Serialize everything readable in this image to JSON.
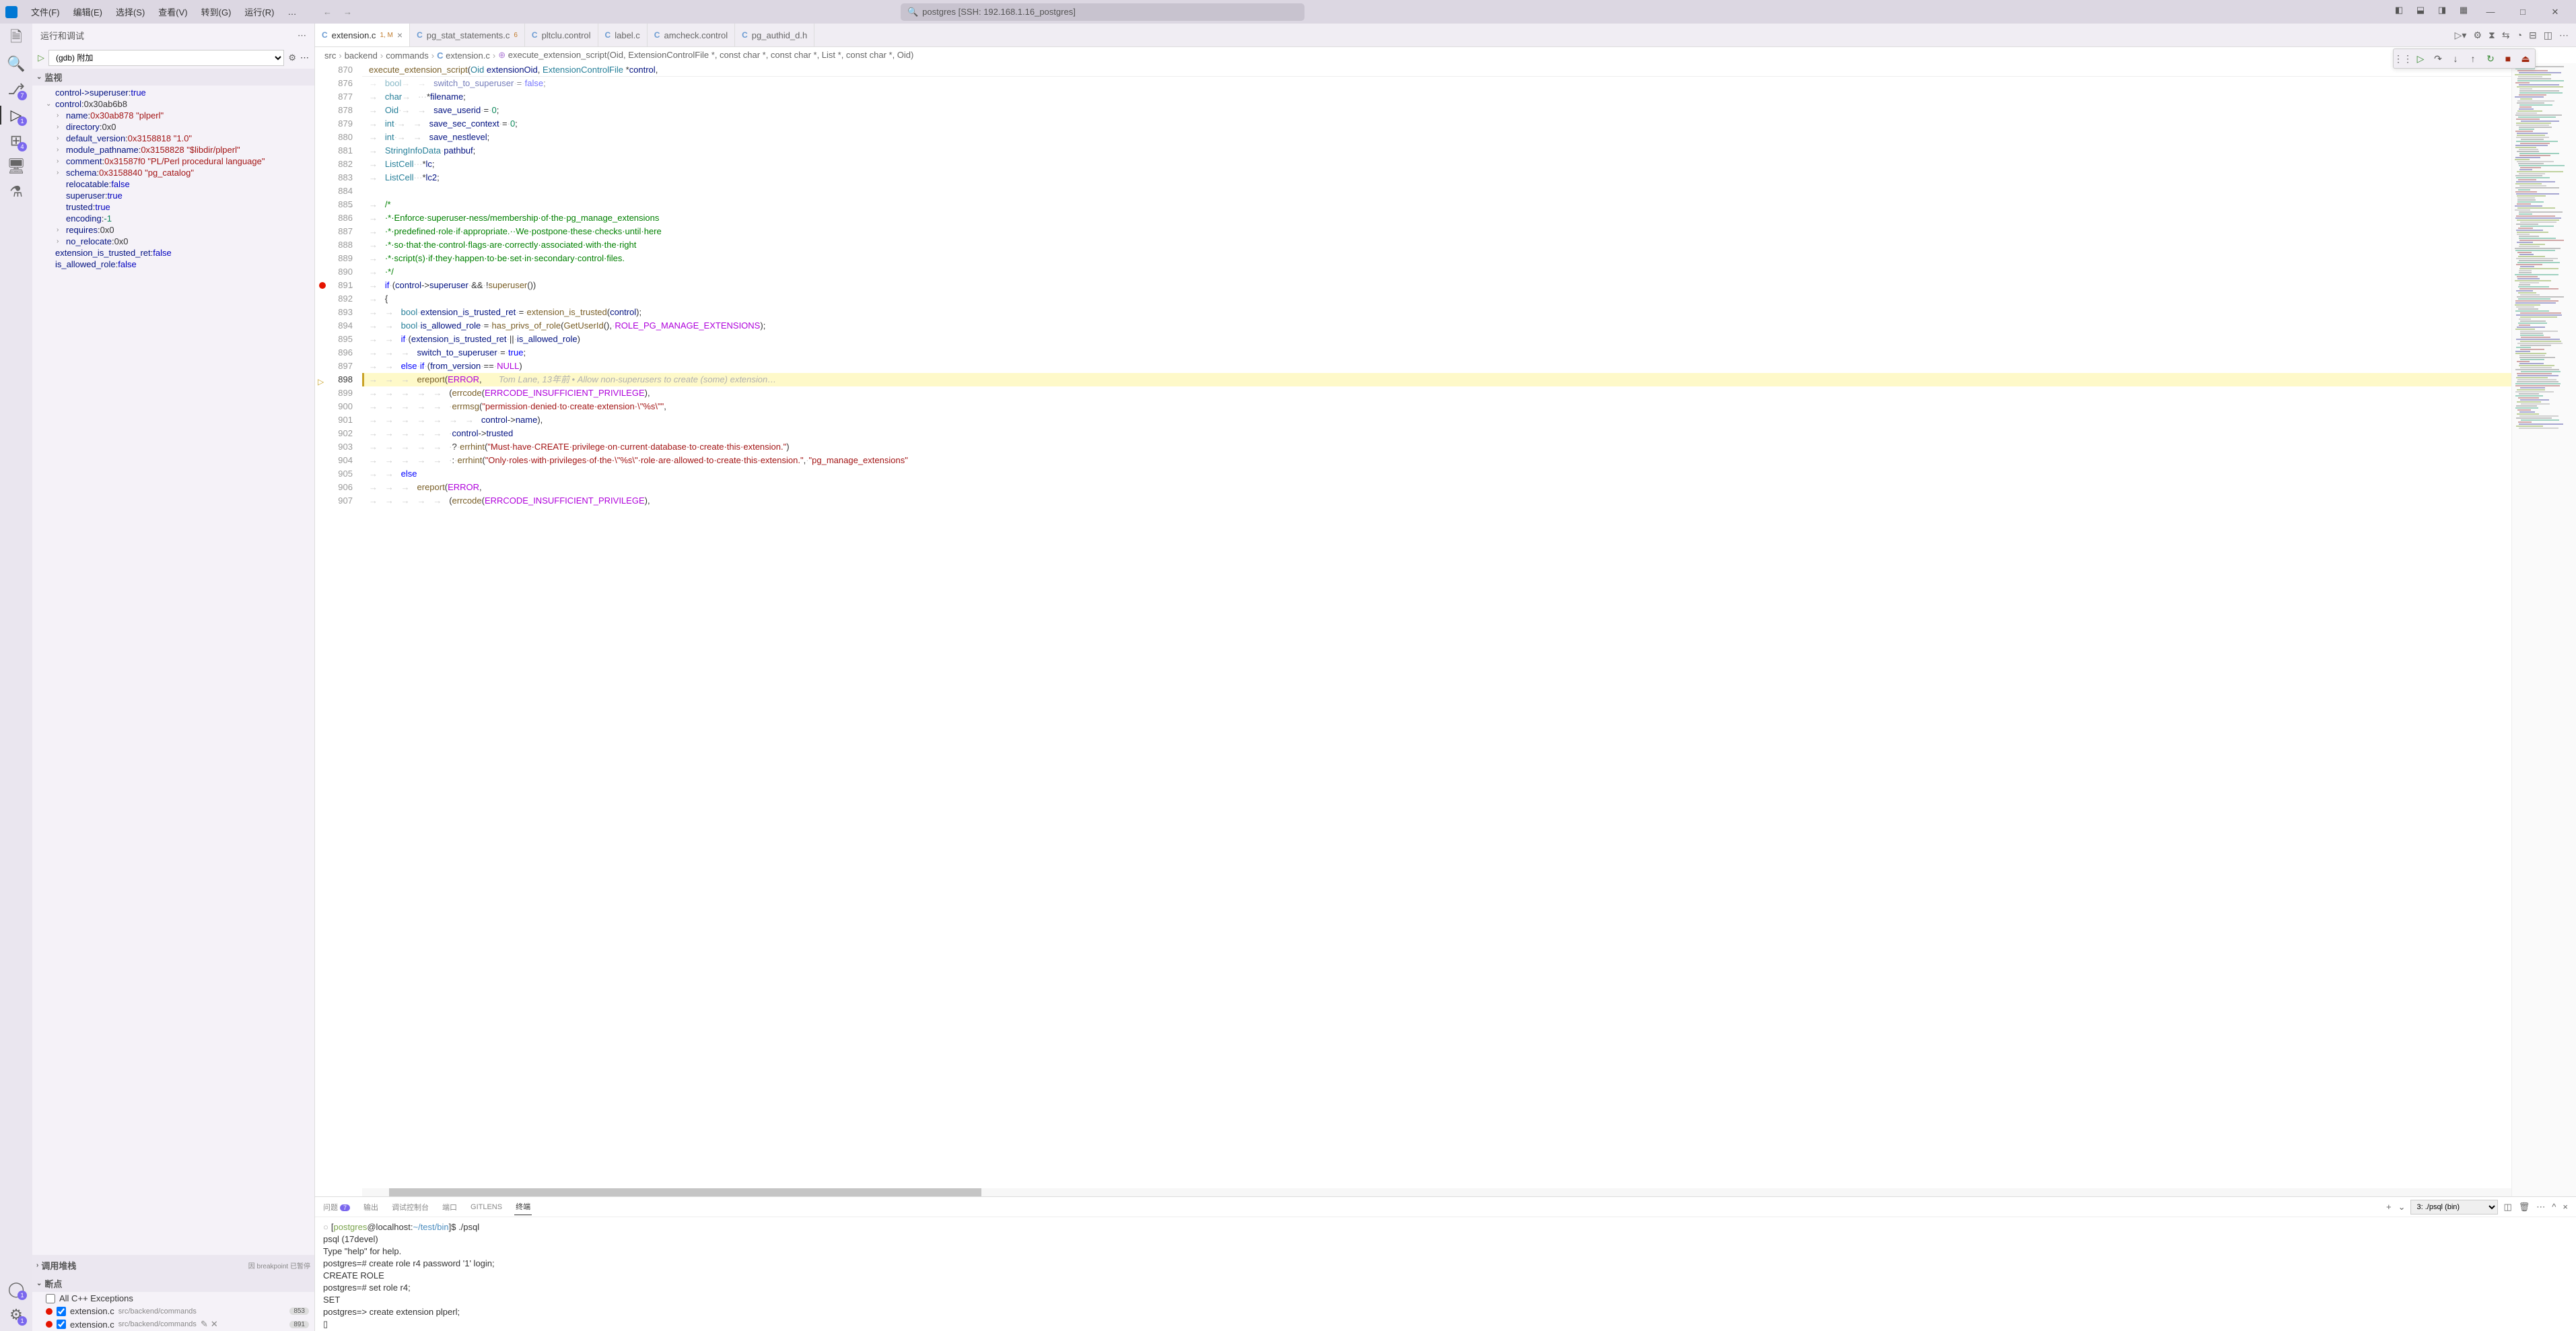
{
  "title": {
    "search_text": "postgres [SSH: 192.168.1.16_postgres]"
  },
  "menu": [
    "文件(F)",
    "编辑(E)",
    "选择(S)",
    "查看(V)",
    "转到(G)",
    "运行(R)",
    "…"
  ],
  "activity": {
    "items": [
      {
        "name": "explorer",
        "glyph": "🗎",
        "badge": null
      },
      {
        "name": "search",
        "glyph": "🔍",
        "badge": null
      },
      {
        "name": "scm",
        "glyph": "⎇",
        "badge": "7"
      },
      {
        "name": "debug",
        "glyph": "▷",
        "badge": "1",
        "active": true
      },
      {
        "name": "extensions",
        "glyph": "⊞",
        "badge": "4"
      },
      {
        "name": "remote",
        "glyph": "🖥",
        "badge": null
      },
      {
        "name": "testing",
        "glyph": "⚗",
        "badge": null
      }
    ],
    "bottom": [
      {
        "name": "account",
        "glyph": "◯",
        "badge": "1"
      },
      {
        "name": "settings",
        "glyph": "⚙",
        "badge": "1"
      }
    ]
  },
  "sidebar": {
    "title": "运行和调试",
    "config": "(gdb) 附加",
    "watch_label": "监视",
    "watch": [
      {
        "k": "control->superuser",
        "indent": 0,
        "chev": "",
        "v": "true",
        "vt": "bool-true"
      },
      {
        "k": "control",
        "indent": 0,
        "chev": "v",
        "v": "0x30ab6b8",
        "vt": "addr"
      },
      {
        "k": "name",
        "indent": 1,
        "chev": ">",
        "v": "0x30ab878 \"plperl\"",
        "vt": "str"
      },
      {
        "k": "directory",
        "indent": 1,
        "chev": ">",
        "v": "0x0",
        "vt": "addr"
      },
      {
        "k": "default_version",
        "indent": 1,
        "chev": ">",
        "v": "0x3158818 \"1.0\"",
        "vt": "str"
      },
      {
        "k": "module_pathname",
        "indent": 1,
        "chev": ">",
        "v": "0x3158828 \"$libdir/plperl\"",
        "vt": "str"
      },
      {
        "k": "comment",
        "indent": 1,
        "chev": ">",
        "v": "0x31587f0 \"PL/Perl procedural language\"",
        "vt": "str"
      },
      {
        "k": "schema",
        "indent": 1,
        "chev": ">",
        "v": "0x3158840 \"pg_catalog\"",
        "vt": "str"
      },
      {
        "k": "relocatable",
        "indent": 1,
        "chev": "",
        "v": "false",
        "vt": "bool-false"
      },
      {
        "k": "superuser",
        "indent": 1,
        "chev": "",
        "v": "true",
        "vt": "bool-true"
      },
      {
        "k": "trusted",
        "indent": 1,
        "chev": "",
        "v": "true",
        "vt": "bool-true"
      },
      {
        "k": "encoding",
        "indent": 1,
        "chev": "",
        "v": "-1",
        "vt": "num"
      },
      {
        "k": "requires",
        "indent": 1,
        "chev": ">",
        "v": "0x0",
        "vt": "addr"
      },
      {
        "k": "no_relocate",
        "indent": 1,
        "chev": ">",
        "v": "0x0",
        "vt": "addr"
      },
      {
        "k": "extension_is_trusted_ret",
        "indent": 0,
        "chev": "",
        "v": "false",
        "vt": "bool-false"
      },
      {
        "k": "is_allowed_role",
        "indent": 0,
        "chev": "",
        "v": "false",
        "vt": "bool-false"
      }
    ],
    "callstack_label": "调用堆栈",
    "callstack_status": "因 breakpoint 已暂停",
    "breakpoints_label": "断点",
    "breakpoints": [
      {
        "label": "All C++ Exceptions",
        "checked": false,
        "file": false
      },
      {
        "file": "extension.c",
        "path": "src/backend/commands",
        "line": "853",
        "checked": true
      },
      {
        "file": "extension.c",
        "path": "src/backend/commands",
        "line": "891",
        "checked": true,
        "actions": true
      }
    ]
  },
  "tabs": [
    {
      "label": "extension.c",
      "mod": "1, M",
      "active": true,
      "close": true
    },
    {
      "label": "pg_stat_statements.c",
      "mod": "6"
    },
    {
      "label": "pltclu.control"
    },
    {
      "label": "label.c"
    },
    {
      "label": "amcheck.control"
    },
    {
      "label": "pg_authid_d.h"
    }
  ],
  "breadcrumb": [
    "src",
    "backend",
    "commands",
    "extension.c",
    "execute_extension_script(Oid, ExtensionControlFile *, const char *, const char *, List *, const char *, Oid)"
  ],
  "editor": {
    "sticky": {
      "ln": "870",
      "html": "<span class='fn'>execute_extension_script</span>(<span class='ty'>Oid</span> <span class='id'>extensionOid</span>, <span class='ty'>ExtensionControlFile</span> *<span class='id'>control</span>,"
    },
    "lines": [
      {
        "ln": "876",
        "html": "<span class='ws'>→   </span><span class='ty'>bool</span><span class='ws'>→   →   </span><span class='id'>switch_to_superuser</span><span class='ws'>·</span>=<span class='ws'>·</span><span class='kw'>false</span>;",
        "dim": true
      },
      {
        "ln": "877",
        "html": "<span class='ws'>→   </span><span class='ty'>char</span><span class='ws'>→   ···</span>*<span class='id'>filename</span>;"
      },
      {
        "ln": "878",
        "html": "<span class='ws'>→   </span><span class='ty'>Oid</span><span class='ws'>·→   →   </span><span class='id'>save_userid</span><span class='ws'>·</span>=<span class='ws'>·</span><span class='nm'>0</span>;"
      },
      {
        "ln": "879",
        "html": "<span class='ws'>→   </span><span class='ty'>int</span><span class='ws'>·→   →   </span><span class='id'>save_sec_context</span><span class='ws'>·</span>=<span class='ws'>·</span><span class='nm'>0</span>;"
      },
      {
        "ln": "880",
        "html": "<span class='ws'>→   </span><span class='ty'>int</span><span class='ws'>·→   →   </span><span class='id'>save_nestlevel</span>;"
      },
      {
        "ln": "881",
        "html": "<span class='ws'>→   </span><span class='ty'>StringInfoData</span><span class='ws'>·</span><span class='id'>pathbuf</span>;"
      },
      {
        "ln": "882",
        "html": "<span class='ws'>→   </span><span class='ty'>ListCell</span><span class='ws'>···</span>*<span class='id'>lc</span>;"
      },
      {
        "ln": "883",
        "html": "<span class='ws'>→   </span><span class='ty'>ListCell</span><span class='ws'>···</span>*<span class='id'>lc2</span>;"
      },
      {
        "ln": "884",
        "html": ""
      },
      {
        "ln": "885",
        "html": "<span class='ws'>→   </span><span class='cm'>/*</span>",
        "fold": true
      },
      {
        "ln": "886",
        "html": "<span class='ws'>→   </span><span class='cm'>·*·Enforce·superuser-ness/membership·of·the·pg_manage_extensions</span>",
        "bl": true
      },
      {
        "ln": "887",
        "html": "<span class='ws'>→   </span><span class='cm'>·*·predefined·role·if·appropriate.··We·postpone·these·checks·until·here</span>",
        "bl": true
      },
      {
        "ln": "888",
        "html": "<span class='ws'>→   </span><span class='cm'>·*·so·that·the·control·flags·are·correctly·associated·with·the·right</span>",
        "bl": true
      },
      {
        "ln": "889",
        "html": "<span class='ws'>→   </span><span class='cm'>·*·script(s)·if·they·happen·to·be·set·in·secondary·control·files.</span>"
      },
      {
        "ln": "890",
        "html": "<span class='ws'>→   </span><span class='cm'>·*/</span>"
      },
      {
        "ln": "891",
        "html": "<span class='ws'>→   </span><span class='kw'>if</span><span class='ws'>·</span>(<span class='id'>control</span>-&gt;<span class='id'>superuser</span><span class='ws'>·</span>&amp;&amp;<span class='ws'>·</span>!<span class='fn'>superuser</span>())",
        "bp": true,
        "fold": true
      },
      {
        "ln": "892",
        "html": "<span class='ws'>→   </span>{"
      },
      {
        "ln": "893",
        "html": "<span class='ws'>→   →   </span><span class='ty'>bool</span><span class='ws'>·</span><span class='id'>extension_is_trusted_ret</span><span class='ws'>·</span>=<span class='ws'>·</span><span class='fn'>extension_is_trusted</span>(<span class='id'>control</span>);",
        "bl": true
      },
      {
        "ln": "894",
        "html": "<span class='ws'>→   →   </span><span class='ty'>bool</span><span class='ws'>·</span><span class='id'>is_allowed_role</span><span class='ws'>·</span>=<span class='ws'>·</span><span class='fn'>has_privs_of_role</span>(<span class='fn'>GetUserId</span>(),<span class='ws'>·</span><span class='mac'>ROLE_PG_MANAGE_EXTENSIONS</span>);",
        "bl": true
      },
      {
        "ln": "895",
        "html": "<span class='ws'>→   →   </span><span class='kw'>if</span><span class='ws'>·</span>(<span class='id'>extension_is_trusted_ret</span><span class='ws'>·</span>||<span class='ws'>·</span><span class='id'>is_allowed_role</span>)",
        "bl": true
      },
      {
        "ln": "896",
        "html": "<span class='ws'>→   →   →   </span><span class='id'>switch_to_superuser</span><span class='ws'>·</span>=<span class='ws'>·</span><span class='kw'>true</span>;"
      },
      {
        "ln": "897",
        "html": "<span class='ws'>→   →   </span><span class='kw'>else</span><span class='ws'>·</span><span class='kw'>if</span><span class='ws'>·</span>(<span class='id'>from_version</span><span class='ws'>·</span>==<span class='ws'>·</span><span class='mac'>NULL</span>)"
      },
      {
        "ln": "898",
        "html": "<span class='ws'>→   →   →   </span><span class='fn'>ereport</span>(<span class='mac'>ERROR</span>,       <span class='blame'>Tom Lane, 13年前 • Allow non-superusers to create (some) extension…</span>",
        "current": true,
        "arrow": true
      },
      {
        "ln": "899",
        "html": "<span class='ws'>→   →   →   →   →   </span>(<span class='fn'>errcode</span>(<span class='mac'>ERRCODE_INSUFFICIENT_PRIVILEGE</span>),"
      },
      {
        "ln": "900",
        "html": "<span class='ws'>→   →   →   →   →   ·</span><span class='fn'>errmsg</span>(<span class='st'>\"permission·denied·to·create·extension·\\\"%s\\\"\"</span>,"
      },
      {
        "ln": "901",
        "html": "<span class='ws'>→   →   →   →   →   →   →   </span><span class='id'>control</span>-&gt;<span class='id'>name</span>),"
      },
      {
        "ln": "902",
        "html": "<span class='ws'>→   →   →   →   →   ·</span><span class='id'>control</span>-&gt;<span class='id'>trusted</span>"
      },
      {
        "ln": "903",
        "html": "<span class='ws'>→   →   →   →   →   ·</span>?<span class='ws'>·</span><span class='fn'>errhint</span>(<span class='st'>\"Must·have·CREATE·privilege·on·current·database·to·create·this·extension.\"</span>)"
      },
      {
        "ln": "904",
        "html": "<span class='ws'>→   →   →   →   →   ·</span>:<span class='ws'>·</span><span class='fn'>errhint</span>(<span class='st'>\"Only·roles·with·privileges·of·the·\\\"%s\\\"·role·are·allowed·to·create·this·extension.\"</span>,<span class='ws'>·</span><span class='st'>\"pg_manage_extensions\"</span>",
        "bl": true
      },
      {
        "ln": "905",
        "html": "<span class='ws'>→   →   </span><span class='kw'>else</span>"
      },
      {
        "ln": "906",
        "html": "<span class='ws'>→   →   →   </span><span class='fn'>ereport</span>(<span class='mac'>ERROR</span>,"
      },
      {
        "ln": "907",
        "html": "<span class='ws'>→   →   →   →   →   </span>(<span class='fn'>errcode</span>(<span class='mac'>ERRCODE_INSUFFICIENT_PRIVILEGE</span>),"
      }
    ]
  },
  "terminal": {
    "tabs": [
      {
        "label": "问题",
        "badge": "7"
      },
      {
        "label": "输出"
      },
      {
        "label": "调试控制台"
      },
      {
        "label": "端口"
      },
      {
        "label": "GITLENS"
      },
      {
        "label": "终端",
        "active": true
      }
    ],
    "shell": "3: ./psql (bin)",
    "lines": [
      {
        "html": "<span class='circle'>○</span>[<span class='prompt-user'>postgres</span><span class='prompt-host'>@localhost:</span><span class='prompt-path'>~/test/bin</span>]$ ./psql"
      },
      {
        "html": "psql (17devel)"
      },
      {
        "html": "Type \"help\" for help."
      },
      {
        "html": ""
      },
      {
        "html": "postgres=# create role r4 password '1' login;"
      },
      {
        "html": "CREATE ROLE"
      },
      {
        "html": "postgres=# set role r4;"
      },
      {
        "html": "SET"
      },
      {
        "html": "postgres=> create extension plperl;"
      },
      {
        "html": "▯"
      }
    ]
  }
}
